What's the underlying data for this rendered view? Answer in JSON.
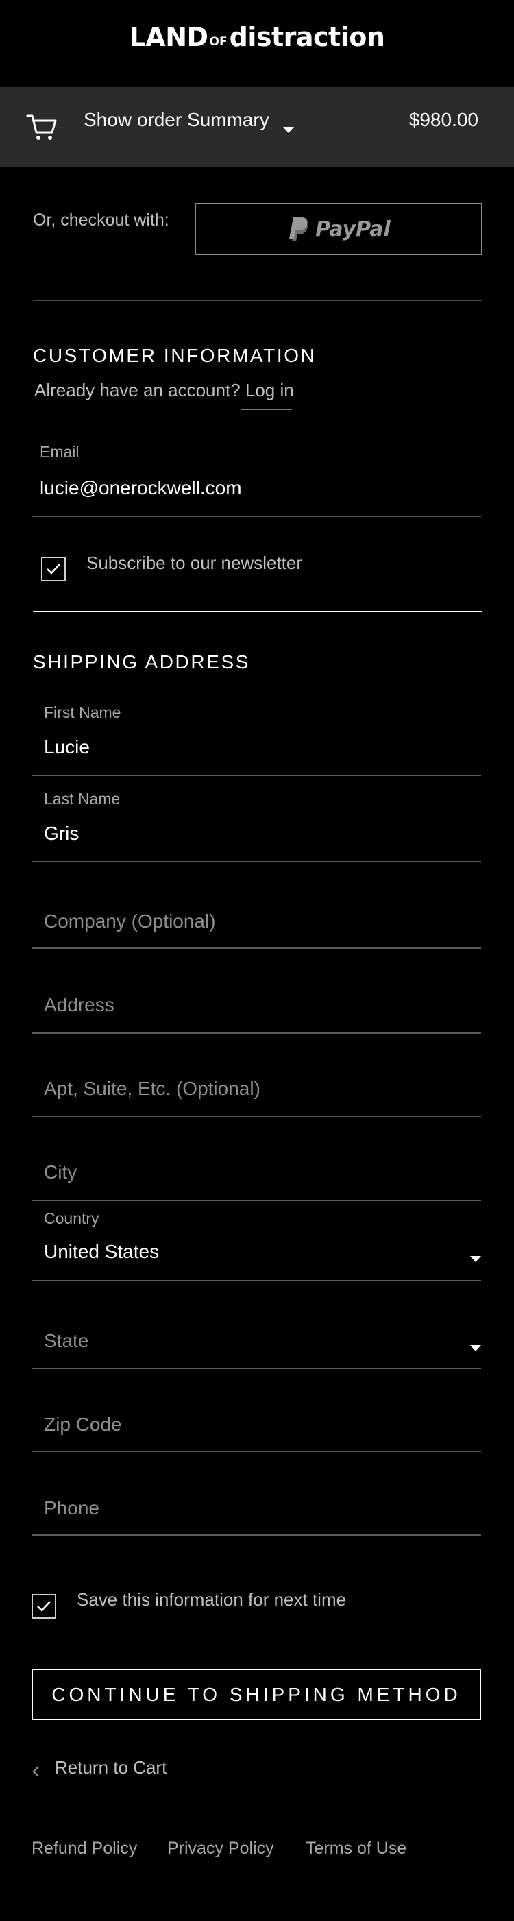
{
  "brand": {
    "part1": "LAND",
    "part2": "OF",
    "part3": "distraction"
  },
  "order_summary": {
    "label": "Show order Summary",
    "total": "$980.00"
  },
  "express_checkout": {
    "label": "Or, checkout with:",
    "paypal_label": "PayPal"
  },
  "customer_info": {
    "title": "CUSTOMER INFORMATION",
    "account_prompt": "Already have an account?",
    "login_label": "Log in",
    "email": {
      "label": "Email",
      "value": "lucie@onerockwell.com"
    },
    "newsletter": {
      "label": "Subscribe to our newsletter",
      "checked": true
    }
  },
  "shipping": {
    "title": "SHIPPING ADDRESS",
    "first_name": {
      "label": "First Name",
      "value": "Lucie"
    },
    "last_name": {
      "label": "Last Name",
      "value": "Gris"
    },
    "company": {
      "placeholder": "Company (Optional)"
    },
    "address": {
      "placeholder": "Address"
    },
    "apt": {
      "placeholder": "Apt, Suite, Etc. (Optional)"
    },
    "city": {
      "placeholder": "City"
    },
    "country": {
      "label": "Country",
      "value": "United States"
    },
    "state": {
      "placeholder": "State"
    },
    "zip": {
      "placeholder": "Zip Code"
    },
    "phone": {
      "placeholder": "Phone"
    }
  },
  "save_info": {
    "label": "Save this information for next time",
    "checked": true
  },
  "continue_button": "CONTINUE TO SHIPPING METHOD",
  "return_link": "Return to Cart",
  "footer": {
    "links": [
      "Refund Policy",
      "Privacy Policy",
      "Terms of Use"
    ]
  },
  "icons": {
    "cart": "cart-icon",
    "paypal": "paypal-icon",
    "chevron_down": "chevron-down-icon",
    "checkmark": "checkmark-icon",
    "chevron_left": "chevron-left-icon"
  },
  "colors": {
    "background": "#000000",
    "summary_bar": "#2b2b2b",
    "text": "#ffffff",
    "muted_text": "#bfbfbf",
    "field_border": "#5a5a5a"
  }
}
